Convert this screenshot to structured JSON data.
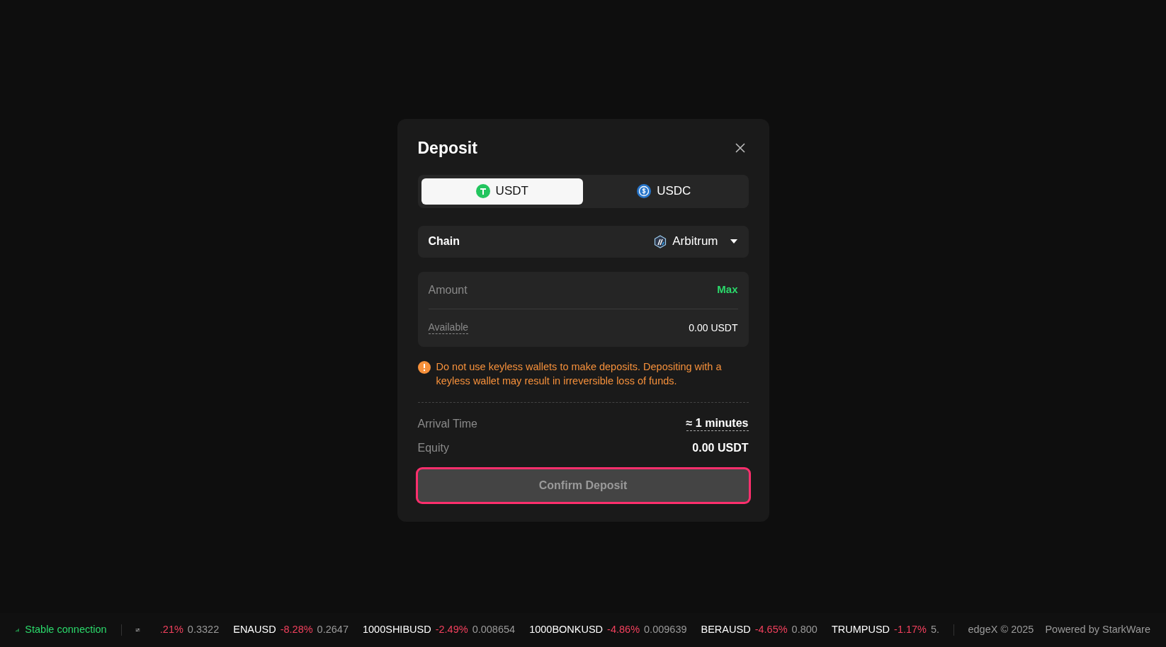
{
  "dialog": {
    "title": "Deposit",
    "tabs": [
      {
        "label": "USDT",
        "kind": "tether",
        "selected": true
      },
      {
        "label": "USDC",
        "kind": "usdc",
        "selected": false
      }
    ],
    "chain": {
      "label": "Chain",
      "value": "Arbitrum"
    },
    "amount": {
      "placeholder": "Amount",
      "max": "Max",
      "available_label": "Available",
      "available_value": "0.00 USDT"
    },
    "warning": "Do not use keyless wallets to make deposits. Depositing with a keyless wallet may result in irreversible loss of funds.",
    "details": [
      {
        "label": "Arrival Time",
        "value": "≈ 1 minutes",
        "underlined": true
      },
      {
        "label": "Equity",
        "value": "0.00 USDT",
        "underlined": false
      }
    ],
    "confirm": {
      "label": "Confirm Deposit",
      "disabled": true,
      "focused": true
    }
  },
  "status_bar": {
    "connection": "Stable connection",
    "ticker": [
      {
        "change": ".21%",
        "price": "0.3322"
      },
      {
        "symbol": "ENAUSD",
        "change": "-8.28%",
        "price": "0.2647"
      },
      {
        "symbol": "1000SHIBUSD",
        "change": "-2.49%",
        "price": "0.008654"
      },
      {
        "symbol": "1000BONKUSD",
        "change": "-4.86%",
        "price": "0.009639"
      },
      {
        "symbol": "BERAUSD",
        "change": "-4.65%",
        "price": "0.800"
      },
      {
        "symbol": "TRUMPUSD",
        "change": "-1.17%",
        "price": "5."
      }
    ],
    "copyright": "edgeX © 2025",
    "powered": "Powered by StarkWare"
  }
}
